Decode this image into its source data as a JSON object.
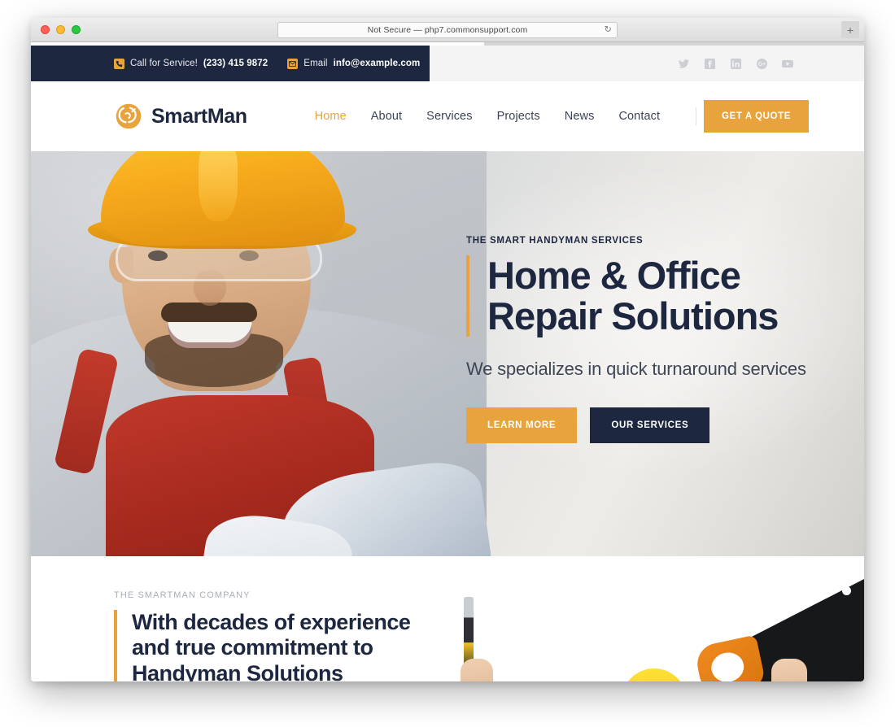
{
  "browser": {
    "url_text": "Not Secure — php7.commonsupport.com",
    "reload_glyph": "↻",
    "newtab_glyph": "+"
  },
  "topbar": {
    "phone": {
      "label": "Call for Service!",
      "value": "(233) 415 9872"
    },
    "email": {
      "label": "Email ",
      "value": "info@example.com"
    },
    "social": [
      "twitter-icon",
      "facebook-icon",
      "linkedin-icon",
      "googleplus-icon",
      "youtube-icon"
    ],
    "bg_color": "#1e2740"
  },
  "header": {
    "brand": "SmartMan",
    "nav": [
      {
        "label": "Home",
        "active": true
      },
      {
        "label": "About",
        "active": false
      },
      {
        "label": "Services",
        "active": false
      },
      {
        "label": "Projects",
        "active": false
      },
      {
        "label": "News",
        "active": false
      },
      {
        "label": "Contact",
        "active": false
      }
    ],
    "quote_label": "GET A QUOTE",
    "accent_color": "#e8a33d"
  },
  "hero": {
    "kicker": "THE SMART HANDYMAN SERVICES",
    "title_line1": "Home & Office",
    "title_line2": "Repair Solutions",
    "subtitle": "We specializes in quick turnaround services",
    "btn_primary": "LEARN MORE",
    "btn_secondary": "OUR SERVICES"
  },
  "about": {
    "kicker": "THE SMARTMAN COMPANY",
    "title_line1": "With decades of experience",
    "title_line2": "and true commitment to",
    "title_line3": "Handyman Solutions"
  }
}
